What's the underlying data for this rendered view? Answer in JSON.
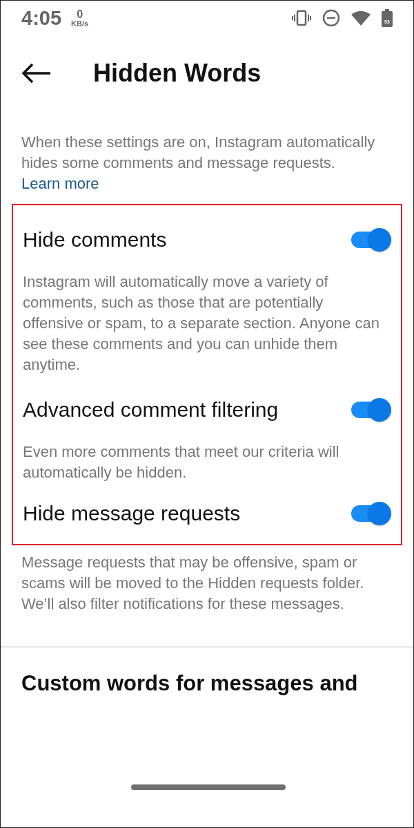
{
  "status_bar": {
    "time": "4:05",
    "speed_value": "0",
    "speed_unit": "KB/s",
    "battery": "53"
  },
  "header": {
    "title": "Hidden Words"
  },
  "intro": {
    "text": "When these settings are on, Instagram automatically hides some comments and message requests.",
    "link": "Learn more"
  },
  "settings": [
    {
      "label": "Hide comments",
      "on": true,
      "description": "Instagram will automatically move a variety of comments, such as those that are potentially offensive or spam, to a separate section. Anyone can see these comments and you can unhide them anytime.",
      "highlighted": true
    },
    {
      "label": "Advanced comment filtering",
      "on": true,
      "description": "Even more comments that meet our criteria will automatically be hidden.",
      "highlighted": true
    },
    {
      "label": "Hide message requests",
      "on": true,
      "description": "Message requests that may be offensive, spam or scams will be moved to the Hidden requests folder. We’ll also filter notifications for these messages.",
      "highlighted": true
    }
  ],
  "custom_section": {
    "title": "Custom words for messages and"
  }
}
